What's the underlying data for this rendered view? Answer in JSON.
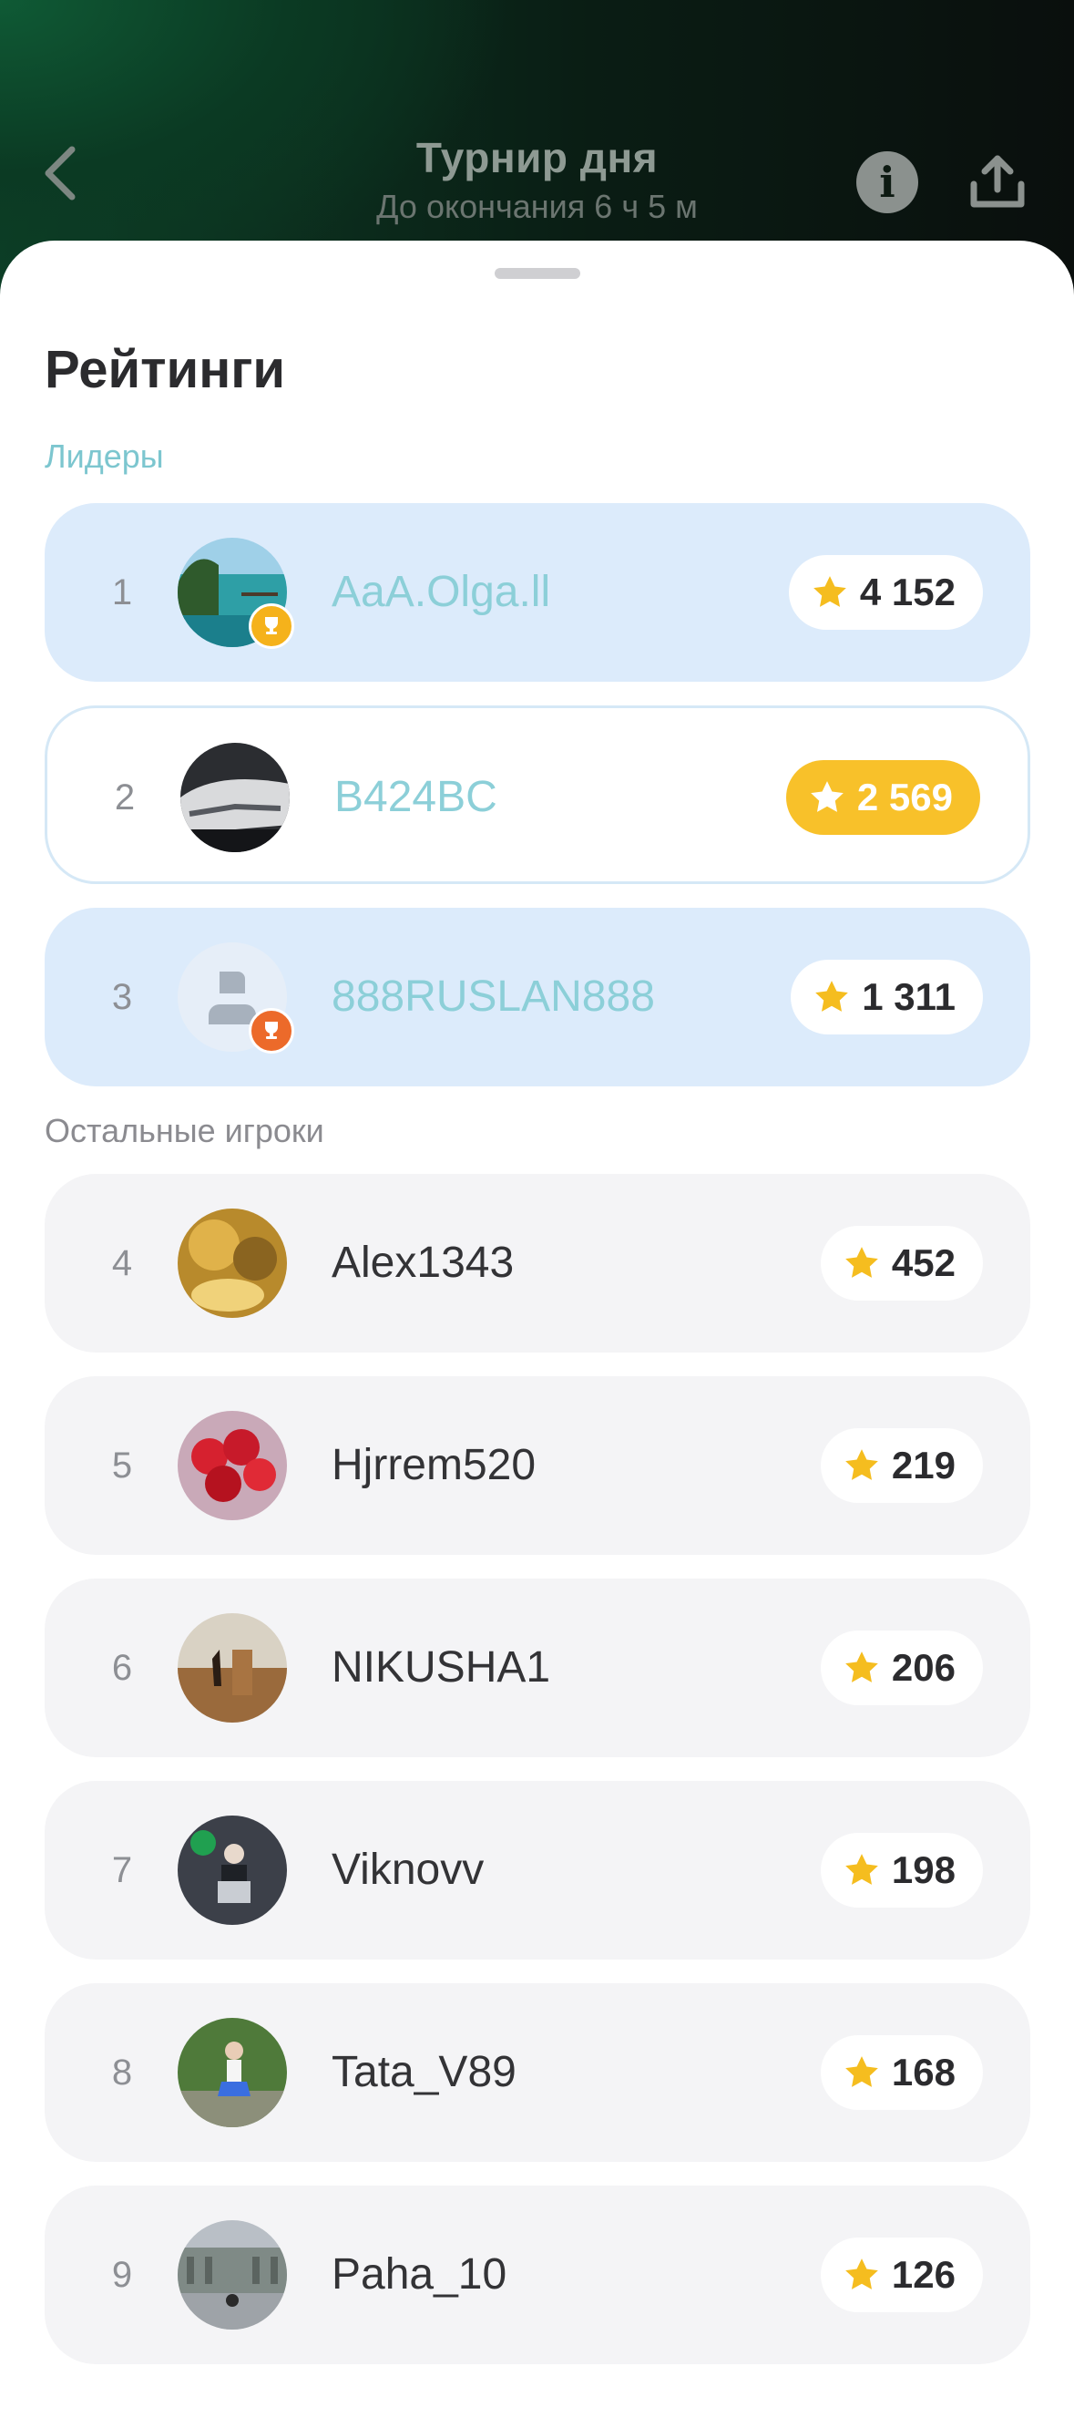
{
  "header": {
    "title": "Турнир дня",
    "subtitle": "До окончания 6 ч 5 м"
  },
  "sheet": {
    "title": "Рейтинги",
    "leaders_label": "Лидеры",
    "others_label": "Остальные игроки"
  },
  "colors": {
    "accent_teal": "#8ccfd8",
    "leader_row_bg": "#dcebfb",
    "star_gold": "#f8c12a",
    "bronze_badge": "#ec6a2a"
  },
  "leaders": [
    {
      "rank": "1",
      "name": "AaA.Olga.ll",
      "score": "4 152",
      "badge": "trophy-gold"
    },
    {
      "rank": "2",
      "name": "B424BC",
      "score": "2 569"
    },
    {
      "rank": "3",
      "name": "888RUSLAN888",
      "score": "1 311",
      "badge": "trophy-bronze"
    }
  ],
  "players": [
    {
      "rank": "4",
      "name": "Alex1343",
      "score": "452"
    },
    {
      "rank": "5",
      "name": "Hjrrem520",
      "score": "219"
    },
    {
      "rank": "6",
      "name": "NIKUSHA1",
      "score": "206"
    },
    {
      "rank": "7",
      "name": "Viknovv",
      "score": "198"
    },
    {
      "rank": "8",
      "name": "Tata_V89",
      "score": "168"
    },
    {
      "rank": "9",
      "name": "Paha_10",
      "score": "126"
    }
  ]
}
